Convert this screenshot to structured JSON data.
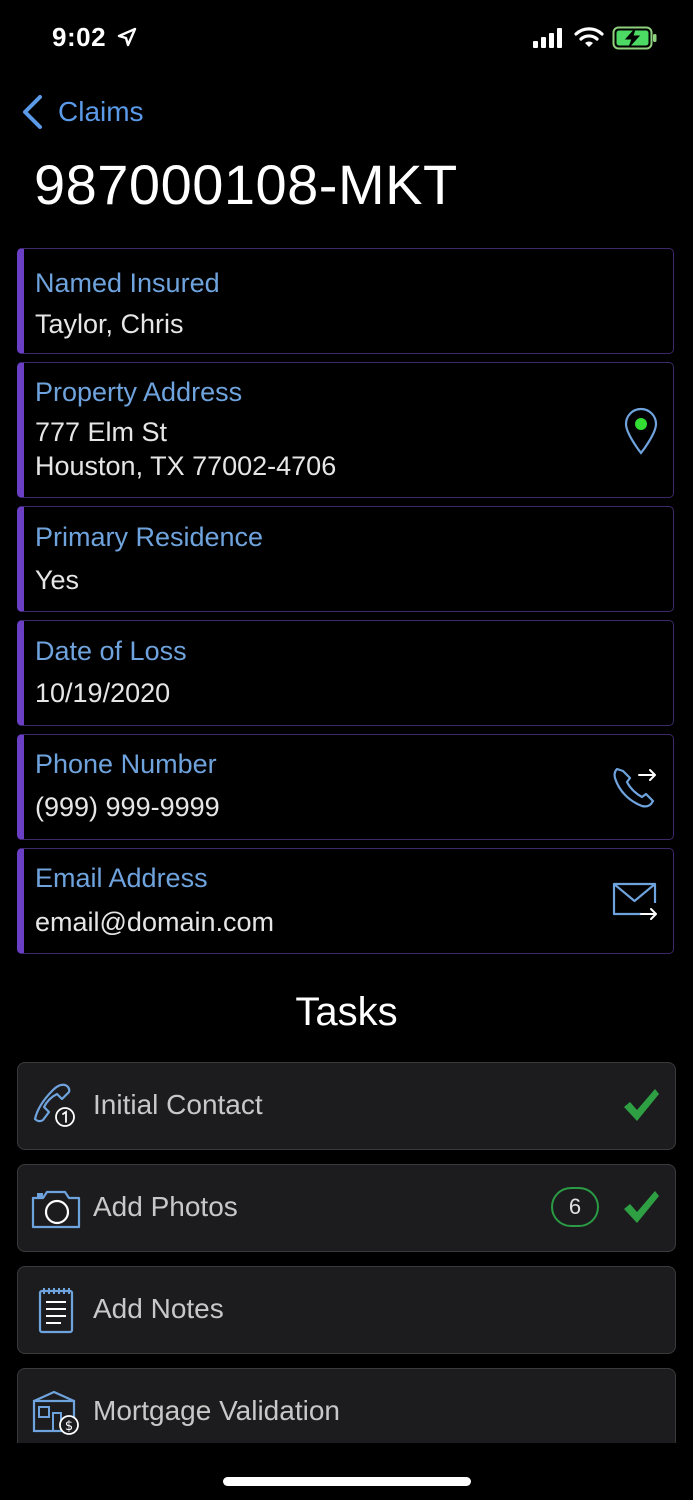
{
  "status": {
    "time": "9:02"
  },
  "nav": {
    "back_label": "Claims"
  },
  "title": "987000108-MKT",
  "fields": [
    {
      "label": "Named Insured",
      "value": "Taylor, Chris"
    },
    {
      "label": "Property Address",
      "line1": "777 Elm St",
      "line2": "Houston, TX 77002-4706",
      "action": "map-pin-icon"
    },
    {
      "label": "Primary Residence",
      "value": "Yes"
    },
    {
      "label": "Date of Loss",
      "value": "10/19/2020"
    },
    {
      "label": "Phone Number",
      "value": "(999) 999-9999",
      "action": "phone-forward-icon"
    },
    {
      "label": "Email Address",
      "value": "email@domain.com",
      "action": "mail-forward-icon"
    }
  ],
  "tasks_heading": "Tasks",
  "tasks": [
    {
      "label": "Initial Contact",
      "icon": "phone-task-icon",
      "done": true
    },
    {
      "label": "Add Photos",
      "icon": "camera-icon",
      "badge": "6",
      "done": true
    },
    {
      "label": "Add Notes",
      "icon": "notepad-icon",
      "done": false
    },
    {
      "label": "Mortgage Validation",
      "icon": "house-dollar-icon",
      "done": false
    }
  ],
  "colors": {
    "accent": "#6fa3dd",
    "link": "#5b9ae8",
    "card_stripe": "#6a3fc4",
    "check": "#2ea043",
    "pin_dot": "#33dd33"
  }
}
